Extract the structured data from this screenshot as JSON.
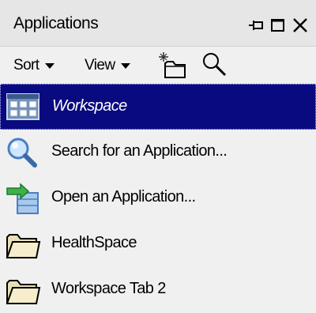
{
  "panel": {
    "title": "Applications"
  },
  "toolbar": {
    "sort_label": "Sort",
    "view_label": "View"
  },
  "items": [
    {
      "label": "Workspace",
      "icon": "workspace-grid-icon",
      "selected": true
    },
    {
      "label": "Search for an Application...",
      "icon": "magnifier-icon",
      "selected": false
    },
    {
      "label": "Open an Application...",
      "icon": "open-application-icon",
      "selected": false
    },
    {
      "label": "HealthSpace",
      "icon": "folder-icon",
      "selected": false
    },
    {
      "label": "Workspace Tab 2",
      "icon": "folder-icon",
      "selected": false
    }
  ],
  "colors": {
    "selection_bg": "#0a0a80",
    "panel_bg": "#f0f0f0",
    "titlebar_bg": "#e6e6e6"
  }
}
